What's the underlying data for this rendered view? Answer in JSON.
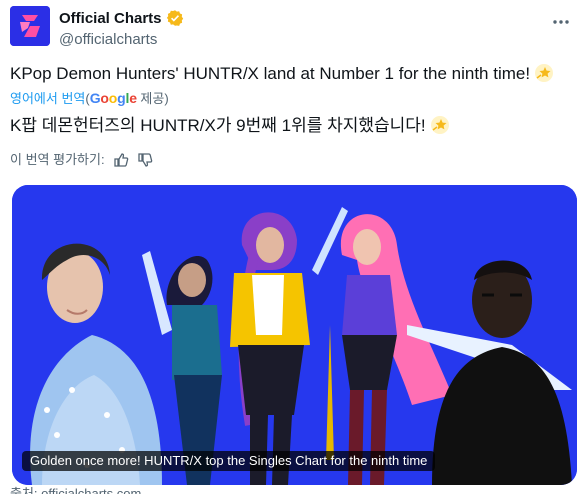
{
  "author": {
    "name": "Official Charts",
    "handle": "@officialcharts",
    "verified_color": "#f6b91a",
    "avatar_color": "#2b2fe6",
    "avatar_icon": "official-charts-logo-icon"
  },
  "tweet": {
    "text": "KPop Demon Hunters' HUNTR/X land at Number 1 for the ninth time!",
    "emoji": "star-sparkle-emoji"
  },
  "translation": {
    "source_link": "영어에서 번역",
    "paren_open": "(",
    "google": "Google",
    "provided": " 제공)",
    "text": "K팝 데몬헌터즈의 HUNTR/X가 9번째 1위를 차지했습니다!",
    "rate_label": "이 번역 평가하기:"
  },
  "media": {
    "caption": "Golden once more! HUNTR/X top the Singles Chart for the ninth time",
    "background": "#2638ee"
  },
  "card_source": "출처: officialcharts.com"
}
